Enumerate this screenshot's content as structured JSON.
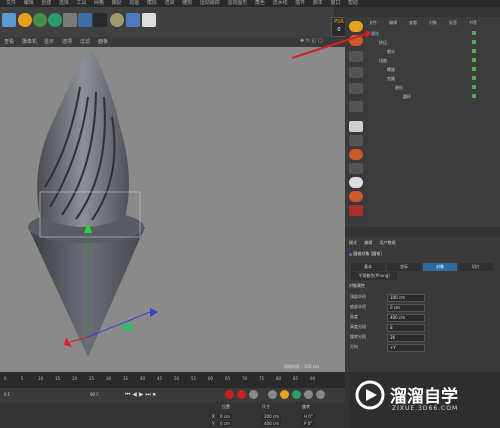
{
  "menubar": [
    "文件",
    "编辑",
    "创建",
    "选择",
    "工具",
    "网格",
    "捕捉",
    "动画",
    "模拟",
    "渲染",
    "雕刻",
    "运动跟踪",
    "运动图形",
    "角色",
    "流水线",
    "插件",
    "脚本",
    "窗口",
    "帮助"
  ],
  "psr": {
    "label": "PSR",
    "value": "0"
  },
  "viewport": {
    "menu": [
      "查看",
      "摄像机",
      "显示",
      "选项",
      "过滤",
      "面板"
    ],
    "grid_spacing_label": "网格间距 : 100 cm"
  },
  "object_manager": {
    "menu": [
      "文件",
      "编辑",
      "查看",
      "对象",
      "标签",
      "书签"
    ],
    "objects": [
      {
        "name": "圆锥",
        "indent": 0,
        "selected": true
      },
      {
        "name": "挤压",
        "indent": 1,
        "selected": false
      },
      {
        "name": "细分",
        "indent": 2,
        "selected": false
      },
      {
        "name": "扭曲",
        "indent": 1,
        "selected": false
      },
      {
        "name": "螺旋",
        "indent": 2,
        "selected": false
      },
      {
        "name": "克隆",
        "indent": 2,
        "selected": false
      },
      {
        "name": "星形",
        "indent": 3,
        "selected": false
      },
      {
        "name": "圆环",
        "indent": 4,
        "selected": false
      }
    ]
  },
  "attribute_manager": {
    "menu": [
      "模式",
      "编辑",
      "用户数据"
    ],
    "title": "圆锥对象 [圆锥]",
    "tabs": [
      "基本",
      "坐标",
      "对象",
      "切片"
    ],
    "active_tab": 2,
    "sub_tab": "平滑着色(Phong)",
    "section": "对象属性",
    "params": [
      {
        "label": "顶部半径",
        "value": "100 cm"
      },
      {
        "label": "底部半径",
        "value": "0 cm"
      },
      {
        "label": "高度",
        "value": "400 cm"
      },
      {
        "label": "高度分段",
        "value": "8"
      },
      {
        "label": "旋转分段",
        "value": "36"
      },
      {
        "label": "方向",
        "value": "+Y"
      }
    ]
  },
  "timeline": {
    "ticks": [
      "0",
      "5",
      "10",
      "15",
      "20",
      "25",
      "30",
      "35",
      "40",
      "45",
      "50",
      "55",
      "60",
      "65",
      "70",
      "75",
      "80",
      "85",
      "90"
    ],
    "start_frame": "0 F",
    "end_frame": "90 F",
    "current_frame": "0 F"
  },
  "coords": {
    "headers": [
      "位置",
      "尺寸",
      "旋转"
    ],
    "rows": [
      {
        "axis": "X",
        "pos": "0 cm",
        "size": "200 cm",
        "rot": "H 0°"
      },
      {
        "axis": "Y",
        "pos": "0 cm",
        "size": "400 cm",
        "rot": "P 0°"
      }
    ]
  },
  "watermark": {
    "brand": "溜溜自学",
    "url": "ZIXUE.3D66.COM"
  },
  "colors": {
    "accent": "#2e6da4",
    "orange": "#e6a21e",
    "arrow": "#d32020"
  }
}
